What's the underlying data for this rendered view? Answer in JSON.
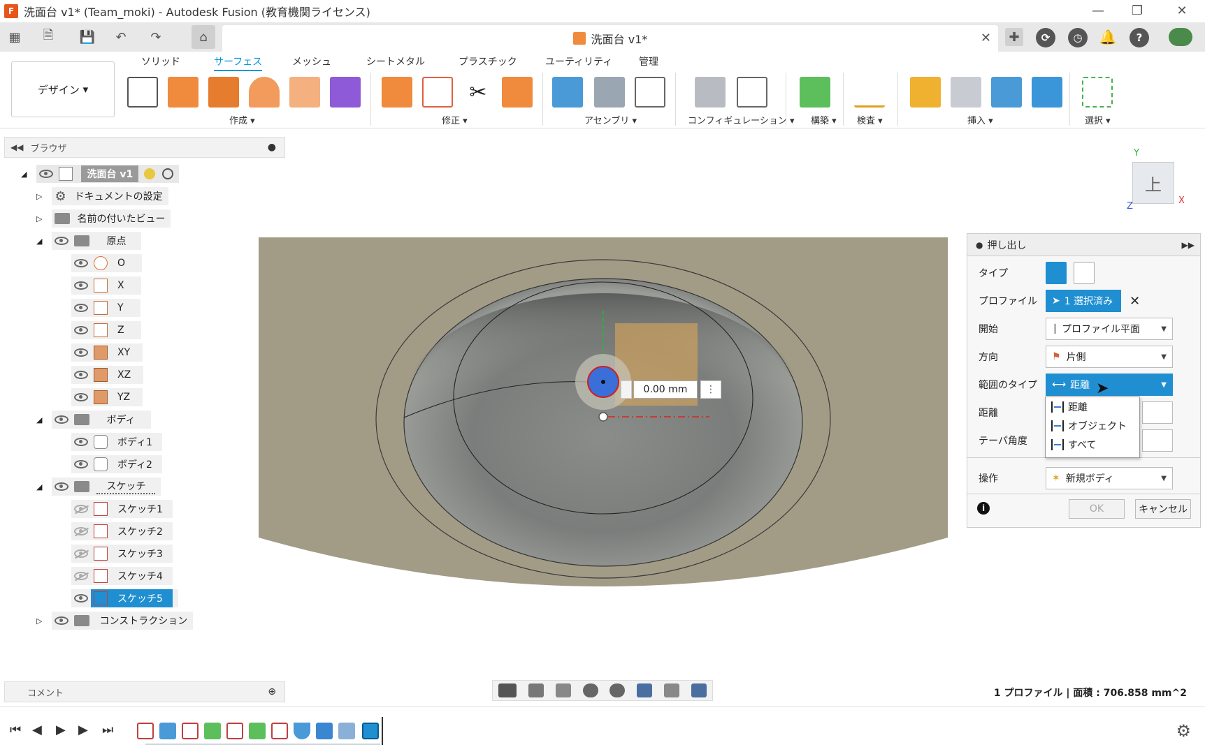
{
  "window": {
    "title": "洗面台 v1* (Team_moki) - Autodesk Fusion (教育機関ライセンス)",
    "app_icon_text": "F"
  },
  "doc_tab": {
    "label": "洗面台 v1*"
  },
  "ribbon": {
    "workspace": "デザイン",
    "tabs": [
      "ソリッド",
      "サーフェス",
      "メッシュ",
      "シートメタル",
      "プラスチック",
      "ユーティリティ",
      "管理"
    ],
    "active_tab": "サーフェス",
    "groups": [
      "作成",
      "修正",
      "アセンブリ",
      "コンフィギュレーション",
      "構築",
      "検査",
      "挿入",
      "選択"
    ]
  },
  "browser": {
    "title": "ブラウザ",
    "root": "洗面台 v1",
    "items": [
      {
        "label": "ドキュメントの設定"
      },
      {
        "label": "名前の付いたビュー"
      },
      {
        "label": "原点"
      },
      {
        "label": "O"
      },
      {
        "label": "X"
      },
      {
        "label": "Y"
      },
      {
        "label": "Z"
      },
      {
        "label": "XY"
      },
      {
        "label": "XZ"
      },
      {
        "label": "YZ"
      },
      {
        "label": "ボディ"
      },
      {
        "label": "ボディ1"
      },
      {
        "label": "ボディ2"
      },
      {
        "label": "スケッチ"
      },
      {
        "label": "スケッチ1"
      },
      {
        "label": "スケッチ2"
      },
      {
        "label": "スケッチ3"
      },
      {
        "label": "スケッチ4"
      },
      {
        "label": "スケッチ5"
      },
      {
        "label": "コンストラクション"
      }
    ]
  },
  "comment": {
    "label": "コメント"
  },
  "viewport": {
    "dimension_value": "0.00 mm"
  },
  "viewcube": {
    "face": "上",
    "axis_x": "X",
    "axis_y": "Y",
    "axis_z": "Z"
  },
  "dialog": {
    "title": "押し出し",
    "labels": {
      "type": "タイプ",
      "profile": "プロファイル",
      "start": "開始",
      "direction": "方向",
      "extent_type": "範囲のタイプ",
      "distance": "距離",
      "taper": "テーパ角度",
      "operation": "操作"
    },
    "profile_value": "1 選択済み",
    "start_value": "プロファイル平面",
    "direction_value": "片側",
    "extent_value": "距離",
    "operation_value": "新規ボディ",
    "ok": "OK",
    "cancel": "キャンセル",
    "dropdown_options": [
      "距離",
      "オブジェクト",
      "すべて"
    ]
  },
  "status": {
    "text": "1 プロファイル | 面積 : 706.858 mm^2"
  },
  "colors": {
    "accent": "#1f8fd1",
    "body_face": "#a29c87",
    "sink_gray": "#7f8280",
    "sketch_box": "#d4a35a"
  }
}
